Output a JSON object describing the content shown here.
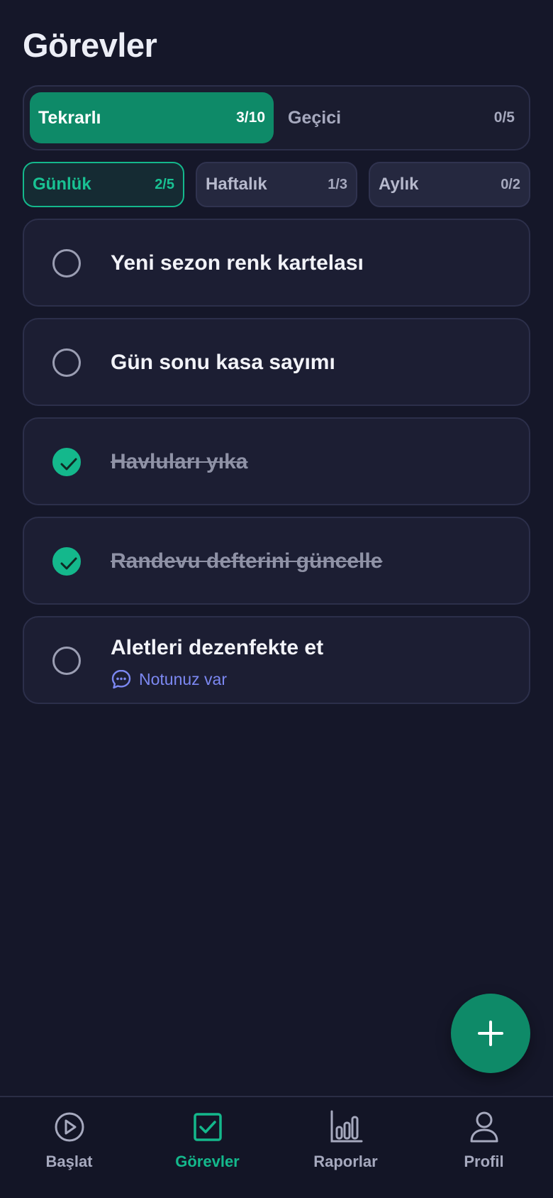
{
  "page": {
    "title": "Görevler"
  },
  "segments": [
    {
      "label": "Tekrarlı",
      "count": "3/10",
      "active": true
    },
    {
      "label": "Geçici",
      "count": "0/5",
      "active": false
    }
  ],
  "subtabs": [
    {
      "label": "Günlük",
      "count": "2/5",
      "active": true
    },
    {
      "label": "Haftalık",
      "count": "1/3",
      "active": false
    },
    {
      "label": "Aylık",
      "count": "0/2",
      "active": false
    }
  ],
  "tasks": [
    {
      "text": "Yeni sezon renk kartelası",
      "done": false
    },
    {
      "text": "Gün sonu kasa sayımı",
      "done": false
    },
    {
      "text": "Havluları yıka",
      "done": true
    },
    {
      "text": "Randevu defterini güncelle",
      "done": true
    },
    {
      "text": "Aletleri dezenfekte et",
      "done": false,
      "note": "Notunuz var"
    }
  ],
  "nav": [
    {
      "label": "Başlat",
      "icon": "play-circle-icon",
      "active": false
    },
    {
      "label": "Görevler",
      "icon": "checkbox-icon",
      "active": true
    },
    {
      "label": "Raporlar",
      "icon": "bar-chart-icon",
      "active": false
    },
    {
      "label": "Profil",
      "icon": "user-icon",
      "active": false
    }
  ],
  "colors": {
    "background": "#151729",
    "accent": "#14b88c",
    "accent_dark": "#0e8a68",
    "note": "#7c88f2"
  }
}
